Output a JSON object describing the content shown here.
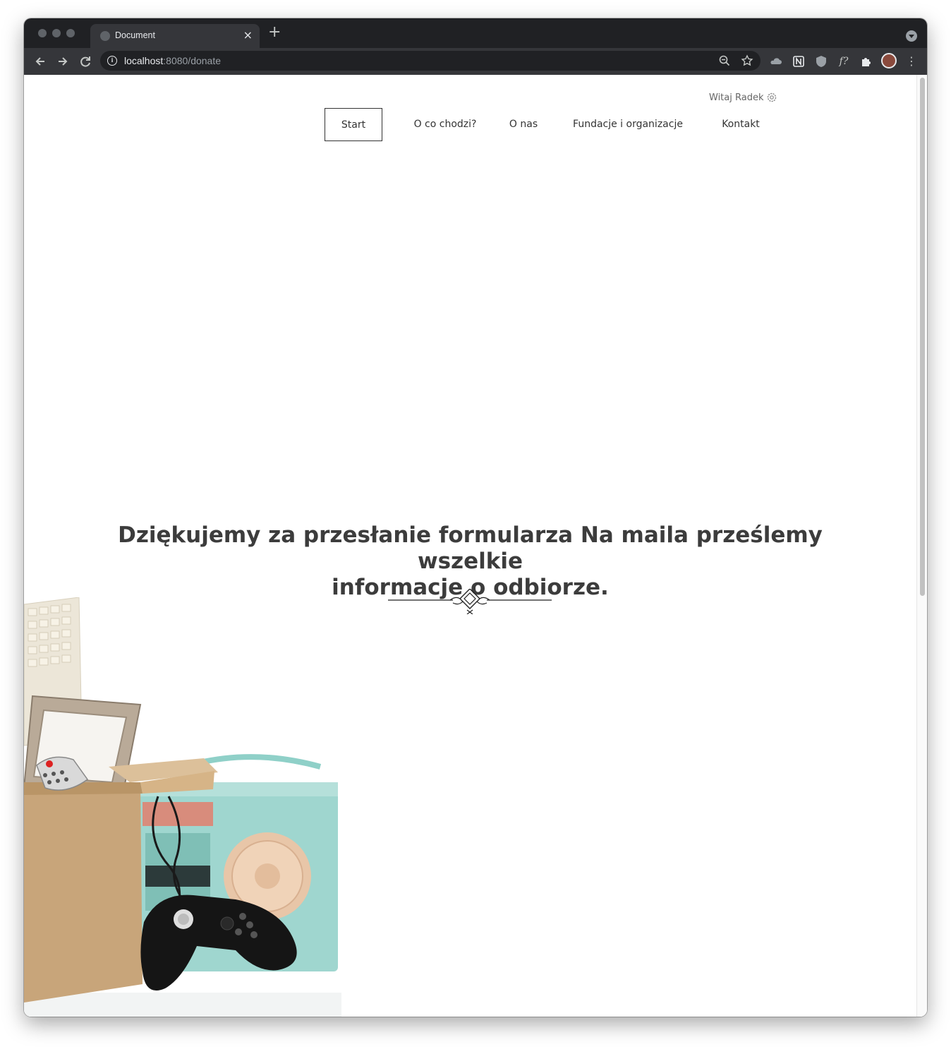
{
  "browser": {
    "tab_title": "Document",
    "tab_close": "×",
    "new_tab": "+",
    "url_host": "localhost",
    "url_rest": ":8080/donate",
    "extensions": [
      "cloud-icon",
      "notion-icon",
      "ublock-icon",
      "font-icon",
      "puzzle-icon"
    ],
    "font_ext_label": "f?"
  },
  "header": {
    "greeting": "Witaj Radek",
    "nav": [
      {
        "label": "Start",
        "active": true
      },
      {
        "label": "O co chodzi?"
      },
      {
        "label": "O nas"
      },
      {
        "label": "Fundacje i organizacje"
      },
      {
        "label": "Kontakt"
      }
    ]
  },
  "main": {
    "headline_line1": "Dziękujemy za przesłanie formularza Na maila prześlemy wszelkie",
    "headline_line2": "informacje o odbiorze."
  },
  "colors": {
    "text_dark": "#3c3c3c",
    "box_cardboard": "#c8a57a",
    "radio_teal": "#9fd6cf"
  }
}
